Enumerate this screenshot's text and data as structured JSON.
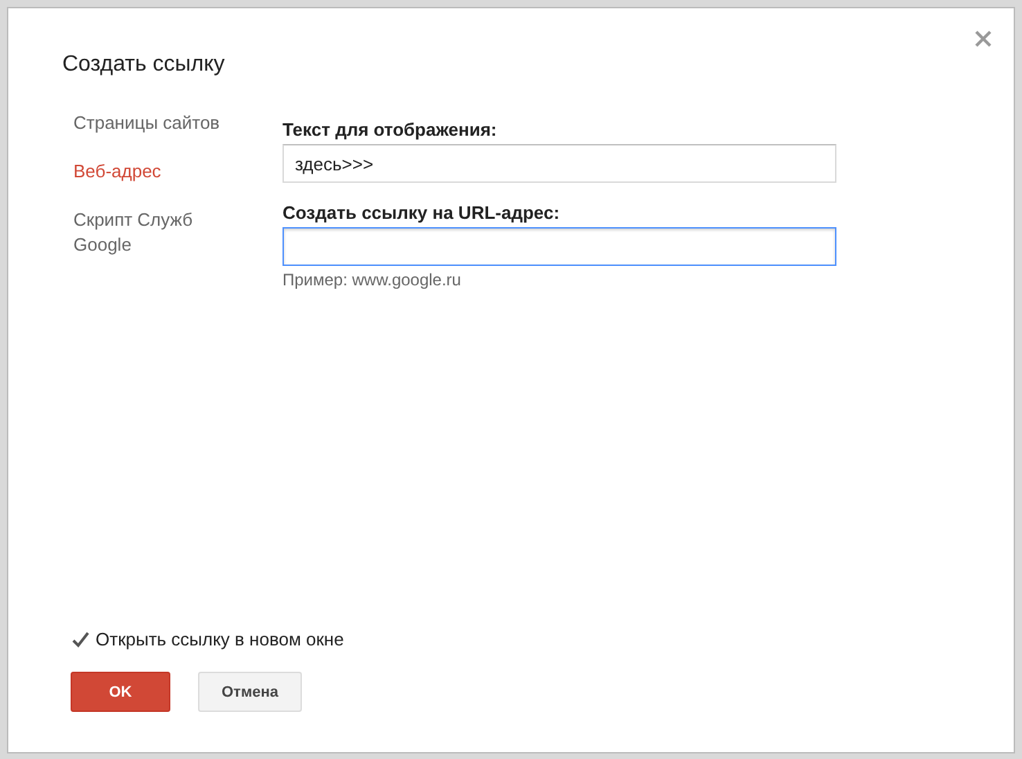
{
  "dialog": {
    "title": "Создать ссылку",
    "sidebar": {
      "items": [
        {
          "label": "Страницы сайтов",
          "selected": false
        },
        {
          "label": "Веб-адрес",
          "selected": true
        },
        {
          "label": "Скрипт Служб Google",
          "selected": false
        }
      ]
    },
    "display_text": {
      "label": "Текст для отображения:",
      "value": "здесь>>>"
    },
    "url": {
      "label": "Создать ссылку на URL-адрес:",
      "focused": true,
      "hint": "Пример: www.google.ru"
    },
    "new_window": {
      "label": "Открыть ссылку в новом окне",
      "checked": true
    },
    "buttons": [
      {
        "label": "OK",
        "kind": "primary"
      },
      {
        "label": "Отмена",
        "kind": "secondary"
      }
    ]
  }
}
